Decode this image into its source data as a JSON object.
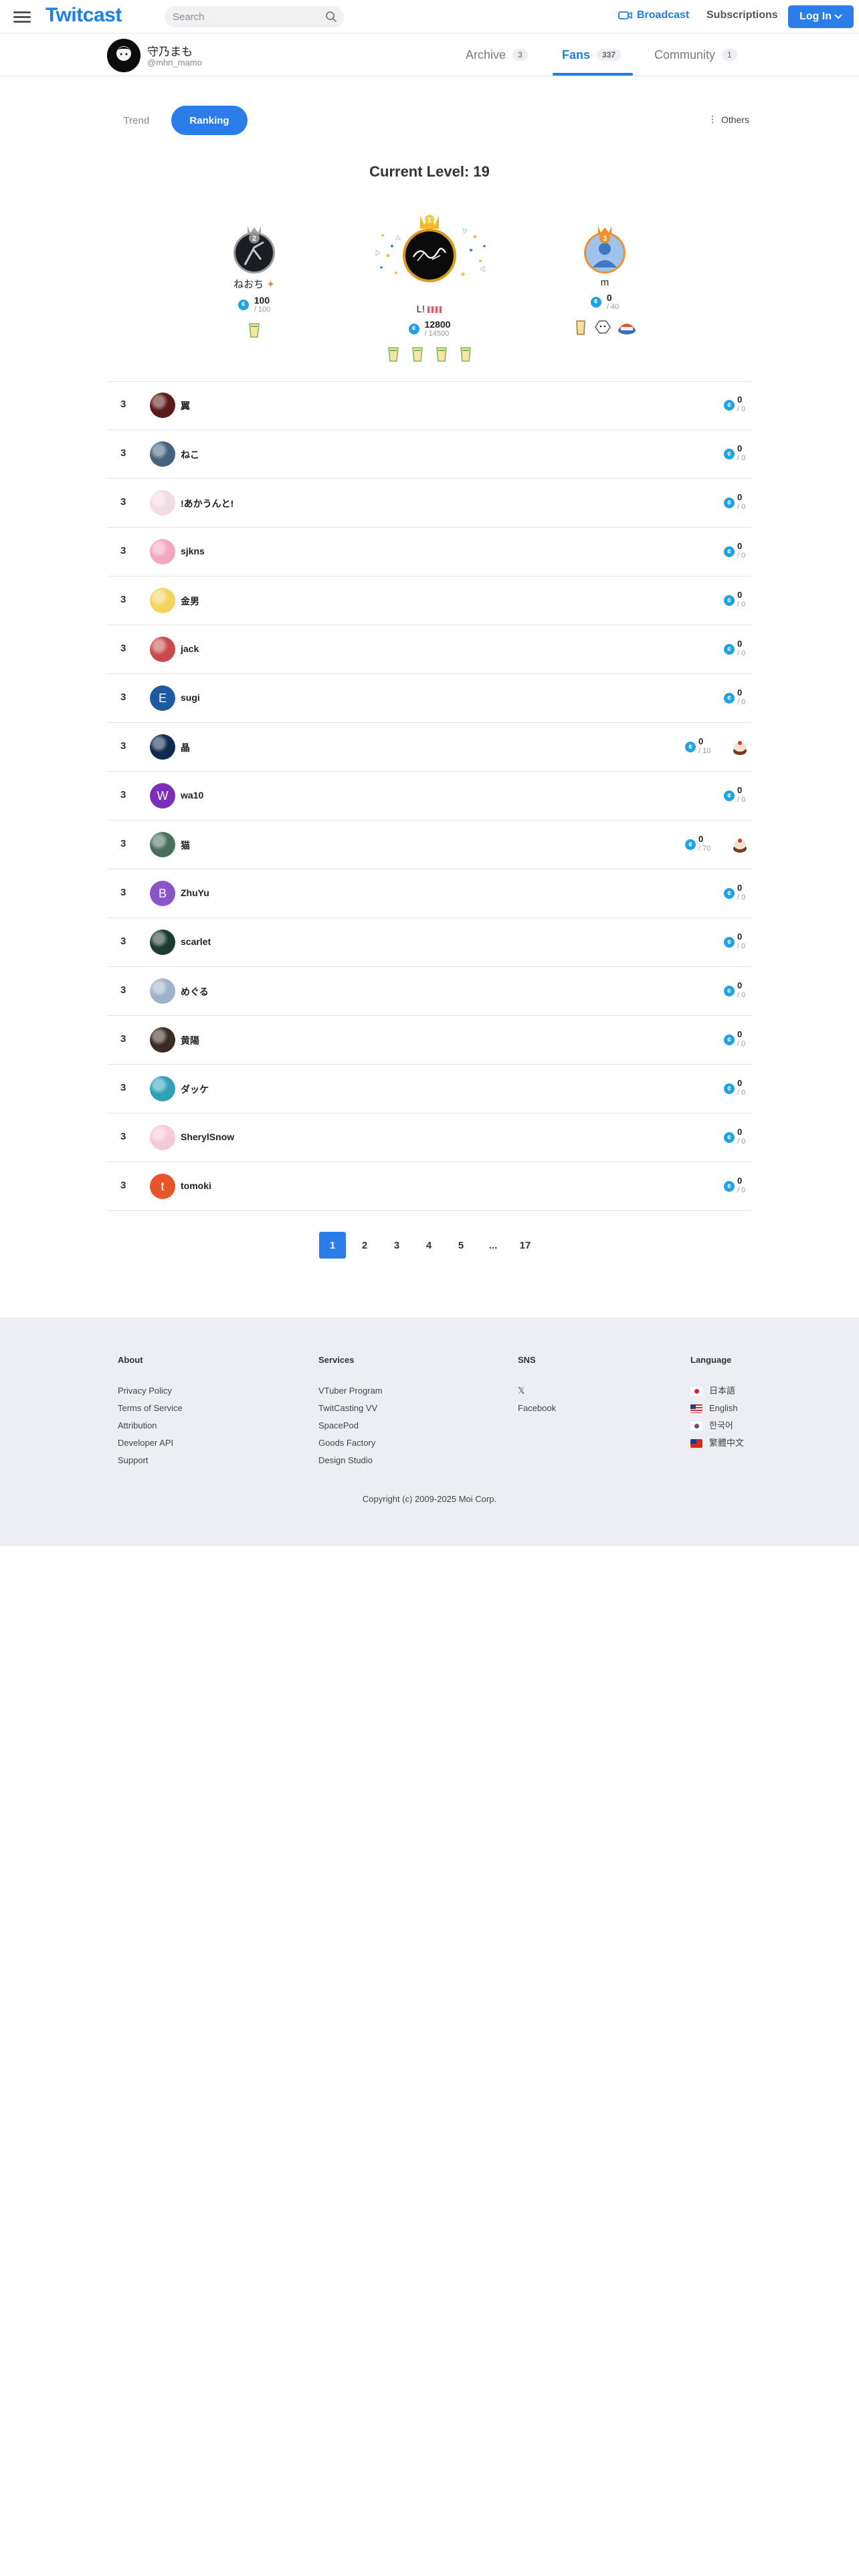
{
  "header": {
    "logo": "Twitcast",
    "search_placeholder": "Search",
    "broadcast": "Broadcast",
    "subscriptions": "Subscriptions",
    "login": "Log In"
  },
  "profile": {
    "name": "守乃まも",
    "handle": "@mhn_mamo",
    "tabs": [
      {
        "label": "Archive",
        "count": "3"
      },
      {
        "label": "Fans",
        "count": "337"
      },
      {
        "label": "Community",
        "count": "1"
      }
    ]
  },
  "toggle": {
    "trend": "Trend",
    "ranking": "Ranking",
    "others": "Others"
  },
  "level_text": "Current Level: 19",
  "podium": {
    "second": {
      "name": "ねおち",
      "points": "100",
      "max": "/ 100",
      "badge": "2",
      "crown_color": "#9a9a9a"
    },
    "first": {
      "name": "L!",
      "points": "12800",
      "max": "/ 14500",
      "badge": "1",
      "crown_color": "#f4b92b"
    },
    "third": {
      "name": "m",
      "points": "0",
      "max": "/ 40",
      "badge": "3",
      "crown_color": "#e98b2c"
    }
  },
  "ranking": [
    {
      "rank": "3",
      "name": "翼",
      "points": "0",
      "max": "/ 0",
      "avatar_color": "#5a1a1a"
    },
    {
      "rank": "3",
      "name": "ねこ",
      "points": "0",
      "max": "/ 0",
      "avatar_color": "#46627d"
    },
    {
      "rank": "3",
      "name": "!あかうんと!",
      "points": "0",
      "max": "/ 0",
      "avatar_color": "#f3dbe3"
    },
    {
      "rank": "3",
      "name": "sjkns",
      "points": "0",
      "max": "/ 0",
      "avatar_color": "#f2a8c0"
    },
    {
      "rank": "3",
      "name": "金男",
      "points": "0",
      "max": "/ 0",
      "avatar_color": "#f5d360"
    },
    {
      "rank": "3",
      "name": "jack",
      "points": "0",
      "max": "/ 0",
      "avatar_color": "#c84b4b"
    },
    {
      "rank": "3",
      "name": "sugi",
      "points": "0",
      "max": "/ 0",
      "avatar_color": "#1d5aa0",
      "initial": "E"
    },
    {
      "rank": "3",
      "name": "晶",
      "points": "0",
      "max": "/ 10",
      "avatar_color": "#0e2a4e",
      "item": true
    },
    {
      "rank": "3",
      "name": "wa10",
      "points": "0",
      "max": "/ 0",
      "avatar_color": "#7b2fb8",
      "initial": "W"
    },
    {
      "rank": "3",
      "name": "猫",
      "points": "0",
      "max": "/ 70",
      "avatar_color": "#4a6f5c",
      "item": true
    },
    {
      "rank": "3",
      "name": "ZhuYu",
      "points": "0",
      "max": "/ 0",
      "avatar_color": "#8a55c9",
      "initial": "B"
    },
    {
      "rank": "3",
      "name": "scarlet",
      "points": "0",
      "max": "/ 0",
      "avatar_color": "#1d3b33"
    },
    {
      "rank": "3",
      "name": "めぐる",
      "points": "0",
      "max": "/ 0",
      "avatar_color": "#9fb2c9"
    },
    {
      "rank": "3",
      "name": "黄陽",
      "points": "0",
      "max": "/ 0",
      "avatar_color": "#3b2b24"
    },
    {
      "rank": "3",
      "name": "ダッケ",
      "points": "0",
      "max": "/ 0",
      "avatar_color": "#2fa0b8"
    },
    {
      "rank": "3",
      "name": "SherylSnow",
      "points": "0",
      "max": "/ 0",
      "avatar_color": "#f7c9d8"
    },
    {
      "rank": "3",
      "name": "tomoki",
      "points": "0",
      "max": "/ 0",
      "avatar_color": "#e8542a",
      "initial": "t"
    }
  ],
  "pagination": [
    "1",
    "2",
    "3",
    "4",
    "5",
    "...",
    "17"
  ],
  "footer": {
    "about": {
      "title": "About",
      "links": [
        "Privacy Policy",
        "Terms of Service",
        "Attribution",
        "Developer API",
        "Support"
      ]
    },
    "services": {
      "title": "Services",
      "links": [
        "VTuber Program",
        "TwitCasting VV",
        "SpacePod",
        "Goods Factory",
        "Design Studio"
      ]
    },
    "sns": {
      "title": "SNS",
      "links": [
        "𝕏",
        "Facebook"
      ]
    },
    "language": {
      "title": "Language",
      "links": [
        "日本語",
        "English",
        "한국어",
        "繁體中文"
      ]
    },
    "copyright": "Copyright (c) 2009-2025 Moi Corp."
  },
  "colors": {
    "accent": "#2b7de9",
    "coin": "#1ea3e6"
  }
}
